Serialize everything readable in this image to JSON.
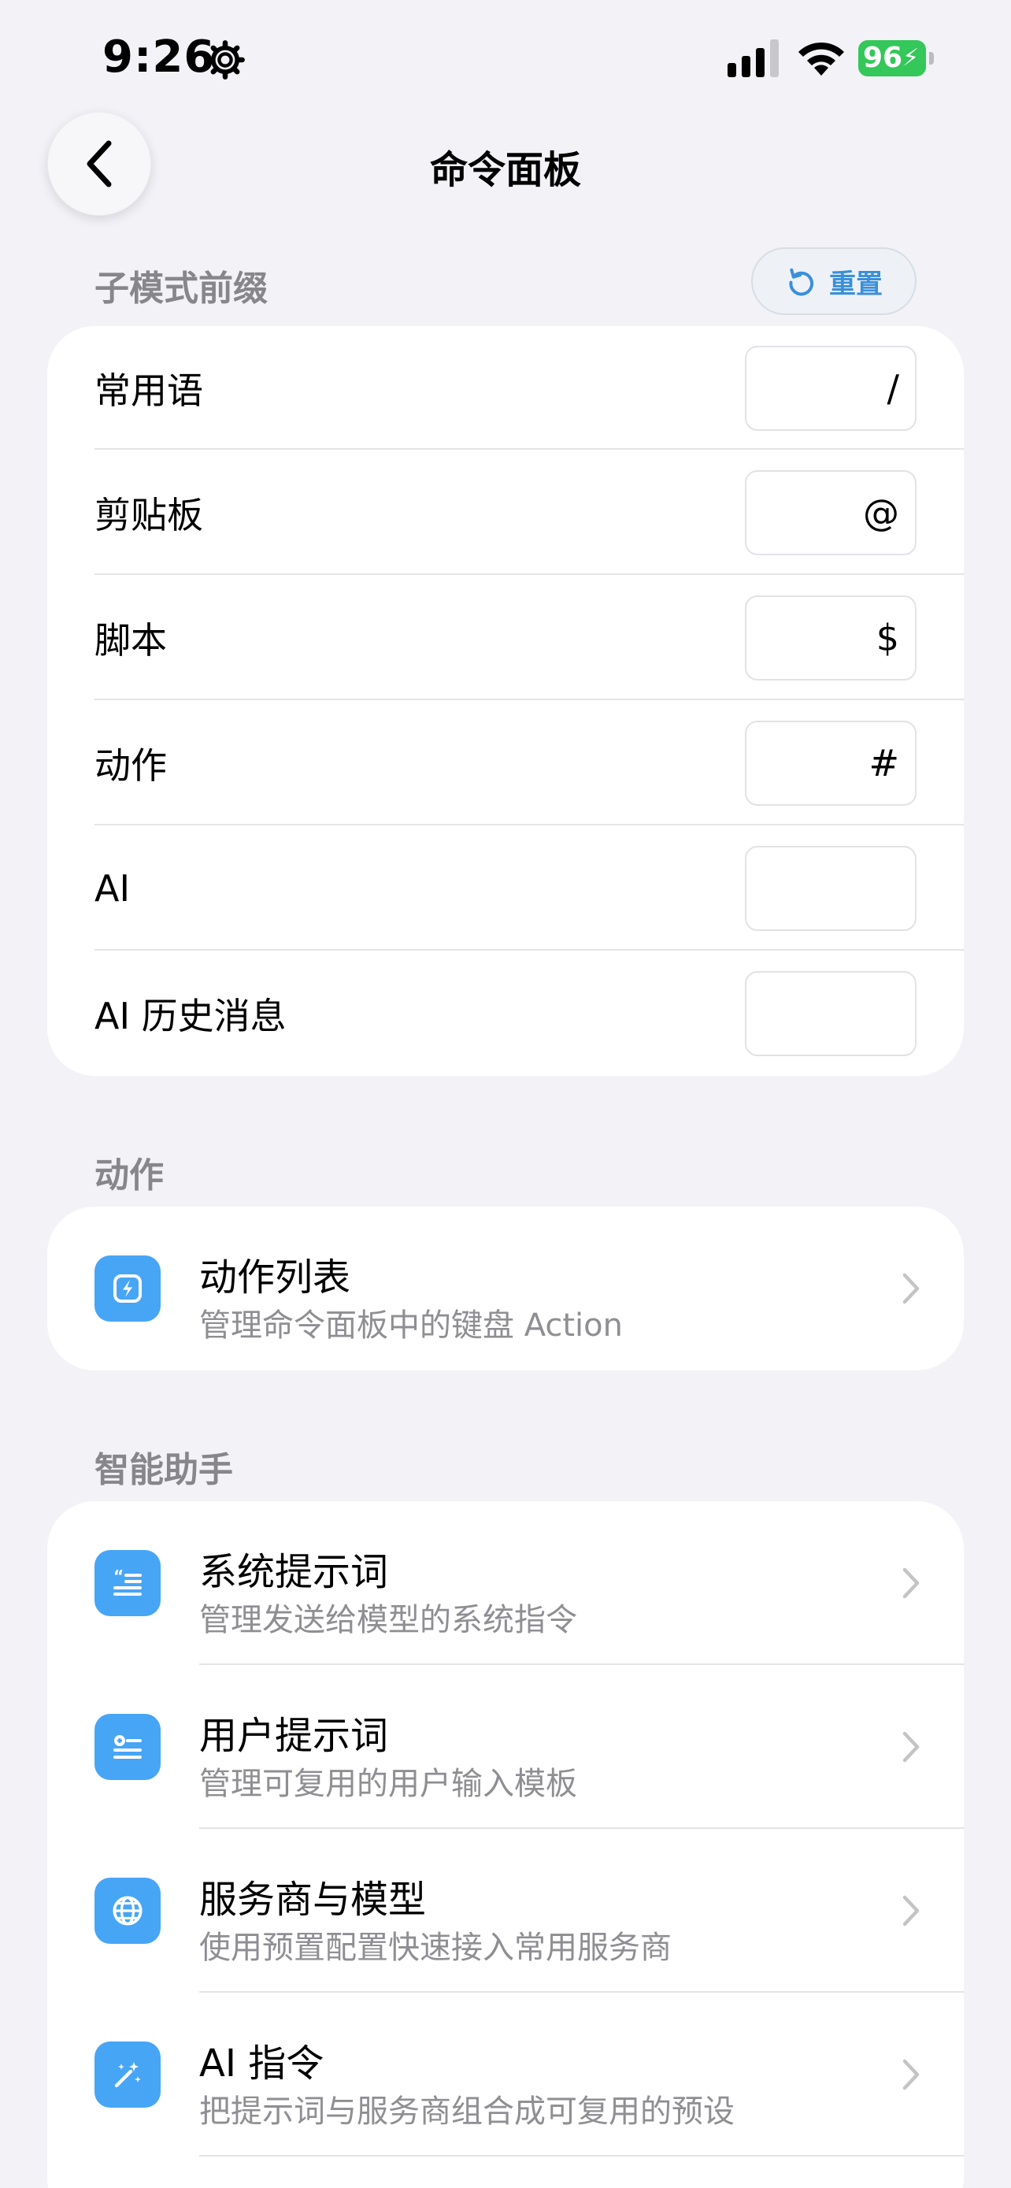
{
  "status": {
    "time": "9:26",
    "battery": "96"
  },
  "nav": {
    "title": "命令面板"
  },
  "prefix_section": {
    "header": "子模式前缀",
    "reset_label": "重置",
    "rows": [
      {
        "label": "常用语",
        "value": "/"
      },
      {
        "label": "剪贴板",
        "value": "@"
      },
      {
        "label": "脚本",
        "value": "$"
      },
      {
        "label": "动作",
        "value": "#"
      },
      {
        "label": "AI",
        "value": ""
      },
      {
        "label": "AI 历史消息",
        "value": ""
      }
    ]
  },
  "actions_section": {
    "header": "动作",
    "items": [
      {
        "title": "动作列表",
        "subtitle": "管理命令面板中的键盘 Action",
        "icon": "bolt-icon"
      }
    ]
  },
  "assistant_section": {
    "header": "智能助手",
    "items": [
      {
        "title": "系统提示词",
        "subtitle": "管理发送给模型的系统指令",
        "icon": "quote-text-icon"
      },
      {
        "title": "用户提示词",
        "subtitle": "管理可复用的用户输入模板",
        "icon": "user-text-icon"
      },
      {
        "title": "服务商与模型",
        "subtitle": "使用预置配置快速接入常用服务商",
        "icon": "globe-icon"
      },
      {
        "title": "AI 指令",
        "subtitle": "把提示词与服务商组合成可复用的预设",
        "icon": "magic-wand-icon"
      }
    ]
  },
  "colors": {
    "accent": "#47a5f6",
    "battery": "#34c759",
    "background": "#f2f2f7"
  }
}
